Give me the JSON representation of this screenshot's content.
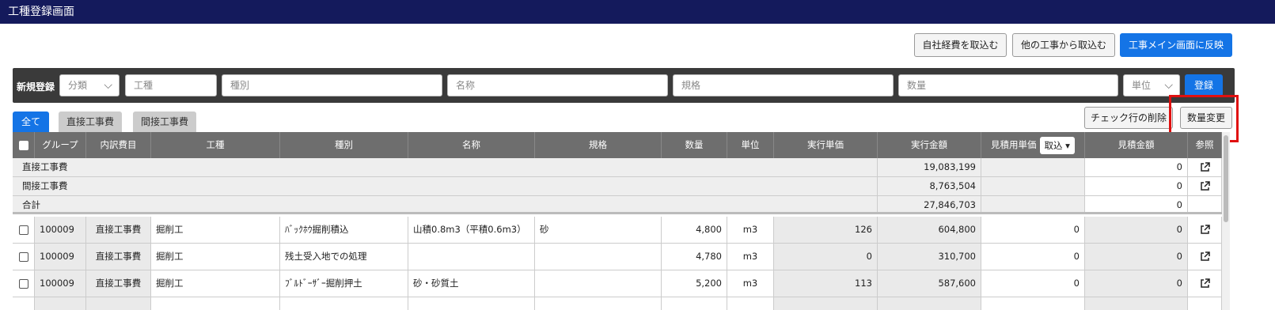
{
  "window": {
    "title": "工種登録画面"
  },
  "toolbar": {
    "import_own": "自社経費を取込む",
    "import_other": "他の工事から取込む",
    "reflect_main": "工事メイン画面に反映"
  },
  "register": {
    "label": "新規登録",
    "category_placeholder": "分類",
    "kouji_placeholder": "工種",
    "shubetsu_placeholder": "種別",
    "name_placeholder": "名称",
    "spec_placeholder": "規格",
    "qty_placeholder": "数量",
    "unit_placeholder": "単位",
    "submit": "登録"
  },
  "tabs": [
    "全て",
    "直接工事費",
    "間接工事費"
  ],
  "actions": {
    "delete_checked": "チェック行の削除",
    "change_qty": "数量変更"
  },
  "table": {
    "columns": [
      "グループ",
      "内訳費目",
      "工種",
      "種別",
      "名称",
      "規格",
      "数量",
      "単位",
      "実行単価",
      "実行金額",
      "見積用単価",
      "見積金額",
      "参照"
    ],
    "estimate_price_option": "取込",
    "summary": [
      {
        "label": "直接工事費",
        "exec_amount": "19,083,199",
        "est_amount": "0"
      },
      {
        "label": "間接工事費",
        "exec_amount": "8,763,504",
        "est_amount": "0"
      },
      {
        "label": "合計",
        "exec_amount": "27,846,703",
        "est_amount": "0"
      }
    ],
    "rows": [
      {
        "group": "100009",
        "cost": "直接工事費",
        "kouji": "掘削工",
        "shubetsu": "ﾊﾞｯｸﾎｳ掘削積込",
        "name": "山積0.8m3（平積0.6m3）",
        "spec": "砂",
        "qty": "4,800",
        "unit": "m3",
        "unit_price": "126",
        "exec_amount": "604,800",
        "est_unit": "0",
        "est_amount": "0"
      },
      {
        "group": "100009",
        "cost": "直接工事費",
        "kouji": "掘削工",
        "shubetsu": "残土受入地での処理",
        "name": "",
        "spec": "",
        "qty": "4,780",
        "unit": "m3",
        "unit_price": "0",
        "exec_amount": "310,700",
        "est_unit": "0",
        "est_amount": "0"
      },
      {
        "group": "100009",
        "cost": "直接工事費",
        "kouji": "掘削工",
        "shubetsu": "ﾌﾞﾙﾄﾞｰｻﾞｰ掘削押土",
        "name": "砂・砂質土",
        "spec": "",
        "qty": "5,200",
        "unit": "m3",
        "unit_price": "113",
        "exec_amount": "587,600",
        "est_unit": "0",
        "est_amount": "0"
      }
    ]
  },
  "colors": {
    "titlebar": "#141a5c",
    "primary": "#1474e6",
    "header": "#6e6e6e",
    "highlight": "#e01010"
  }
}
